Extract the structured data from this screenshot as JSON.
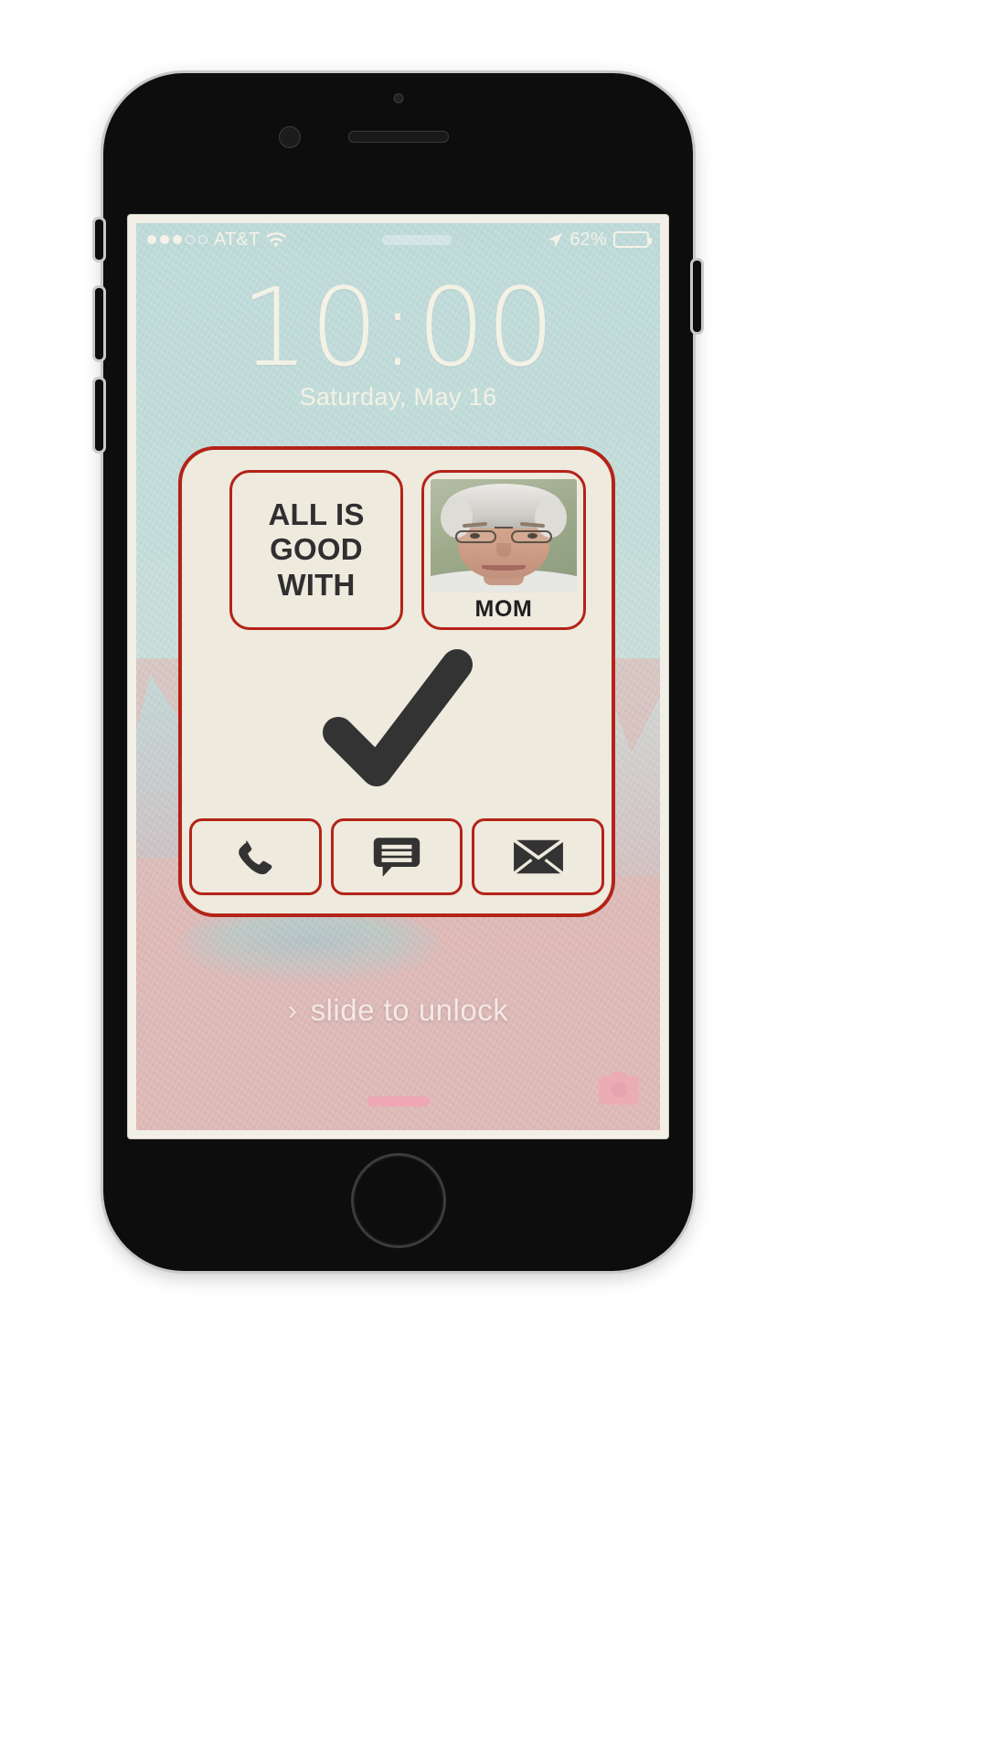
{
  "device": {
    "name": "iphone-mockup",
    "hardware": {
      "earpiece": "earpiece-speaker",
      "front_camera": "front-camera",
      "proximity_sensor": "proximity-sensor",
      "home_button": "home-button",
      "silent_switch": "silent-switch",
      "volume_up": "volume-up-button",
      "volume_down": "volume-down-button",
      "power": "power-button"
    }
  },
  "status_bar": {
    "signal_dots_total": 5,
    "signal_dots_filled": 3,
    "carrier": "AT&T",
    "wifi_icon": "wifi-icon",
    "location_icon": "location-arrow-icon",
    "battery_percent_label": "62%",
    "battery_level": 62,
    "center_pill": ""
  },
  "lock_screen": {
    "time": "10:00",
    "date": "Saturday, May 16",
    "slide_chevron": "›",
    "slide_label": "slide to unlock",
    "camera_icon": "camera-icon",
    "home_indicator": "home-indicator"
  },
  "assist_card": {
    "message_text": "ALL IS GOOD WITH",
    "contact": {
      "name": "MOM",
      "photo_alt": "contact-photo-mom"
    },
    "status_icon": "checkmark-icon",
    "actions": [
      {
        "name": "call-button",
        "icon": "phone-icon"
      },
      {
        "name": "message-button",
        "icon": "message-bubble-icon"
      },
      {
        "name": "email-button",
        "icon": "envelope-icon"
      }
    ]
  },
  "colors": {
    "card_border": "#b42318",
    "card_background": "#eeeade",
    "icon_dark": "#333333",
    "status_text": "#f5f2e9",
    "sky": "#bfdcda",
    "ground": "#e0b9b6",
    "home_indicator": "#efa7b5"
  }
}
